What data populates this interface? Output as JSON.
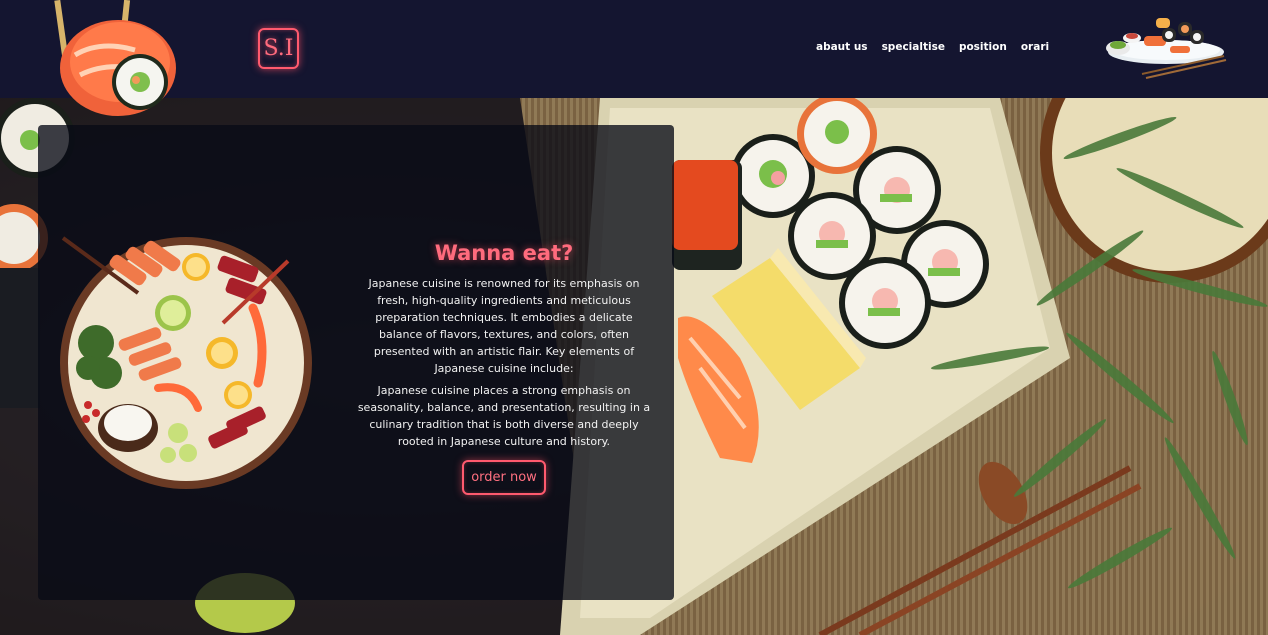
{
  "header": {
    "logo_text": "S.I",
    "nav": [
      {
        "label": "abaut us"
      },
      {
        "label": "specialtise"
      },
      {
        "label": "position"
      },
      {
        "label": "orari"
      }
    ]
  },
  "hero": {
    "title": "Wanna eat?",
    "paragraph_1": "Japanese cuisine is renowned for its emphasis on fresh, high-quality ingredients and meticulous preparation techniques. It embodies a delicate balance of flavors, textures, and colors, often presented with an artistic flair. Key elements of Japanese cuisine include:",
    "paragraph_2": "Japanese cuisine places a strong emphasis on seasonality, balance, and presentation, resulting in a culinary tradition that is both diverse and deeply rooted in Japanese culture and history.",
    "order_button": "order now"
  },
  "colors": {
    "header_bg": "#141530",
    "accent": "#ff6b7d",
    "card_bg": "rgba(8,10,22,0.78)"
  }
}
